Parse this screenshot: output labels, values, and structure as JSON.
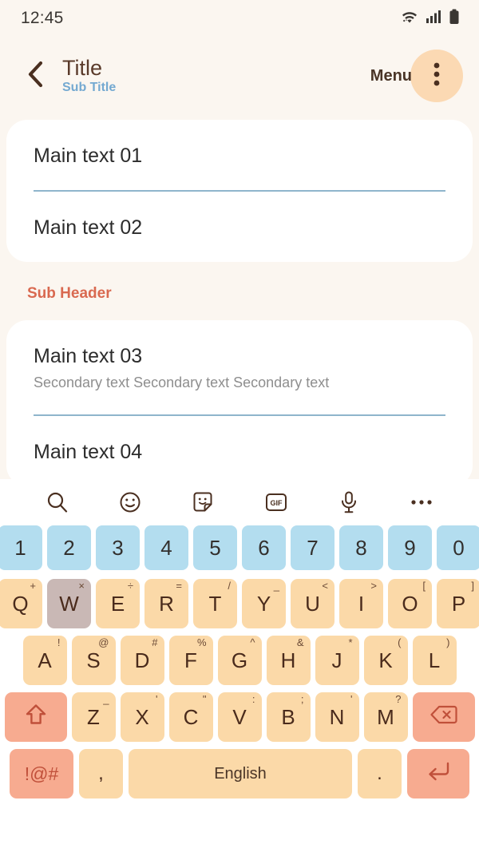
{
  "status_bar": {
    "time": "12:45",
    "icons": [
      "wifi-icon",
      "signal-icon",
      "battery-icon"
    ]
  },
  "app_bar": {
    "back_icon": "back-chevron-icon",
    "title": "Title",
    "subtitle": "Sub Title",
    "menu_label": "Menu",
    "overflow_icon": "overflow-menu-icon",
    "accent_color": "#fbd9b3",
    "title_color": "#5a3a2a",
    "subtitle_color": "#74a9d1"
  },
  "content": {
    "group_one": [
      {
        "main": "Main text 01",
        "secondary": ""
      },
      {
        "main": "Main text 02",
        "secondary": ""
      }
    ],
    "sub_header": "Sub Header",
    "sub_header_color": "#d96950",
    "group_two": [
      {
        "main": "Main text 03",
        "secondary": "Secondary text Secondary text Secondary text"
      },
      {
        "main": "Main text 04",
        "secondary": ""
      }
    ],
    "divider_color": "#8fb5cc"
  },
  "keyboard": {
    "toolbar": [
      {
        "name": "search-icon",
        "label": ""
      },
      {
        "name": "emoji-icon",
        "label": ""
      },
      {
        "name": "sticker-icon",
        "label": ""
      },
      {
        "name": "gif-icon",
        "label": "GIF"
      },
      {
        "name": "microphone-icon",
        "label": ""
      },
      {
        "name": "more-options-icon",
        "label": ""
      }
    ],
    "number_row": [
      "1",
      "2",
      "3",
      "4",
      "5",
      "6",
      "7",
      "8",
      "9",
      "0"
    ],
    "row_qwerty": [
      {
        "label": "Q",
        "sup": "+",
        "pressed": false
      },
      {
        "label": "W",
        "sup": "×",
        "pressed": true
      },
      {
        "label": "E",
        "sup": "÷",
        "pressed": false
      },
      {
        "label": "R",
        "sup": "=",
        "pressed": false
      },
      {
        "label": "T",
        "sup": "/",
        "pressed": false
      },
      {
        "label": "Y",
        "sup": "_",
        "pressed": false
      },
      {
        "label": "U",
        "sup": "<",
        "pressed": false
      },
      {
        "label": "I",
        "sup": ">",
        "pressed": false
      },
      {
        "label": "O",
        "sup": "[",
        "pressed": false
      },
      {
        "label": "P",
        "sup": "]",
        "pressed": false
      }
    ],
    "row_asdf": [
      {
        "label": "A",
        "sup": "!"
      },
      {
        "label": "S",
        "sup": "@"
      },
      {
        "label": "D",
        "sup": "#"
      },
      {
        "label": "F",
        "sup": "%"
      },
      {
        "label": "G",
        "sup": "^"
      },
      {
        "label": "H",
        "sup": "&"
      },
      {
        "label": "J",
        "sup": "*"
      },
      {
        "label": "K",
        "sup": "("
      },
      {
        "label": "L",
        "sup": ")"
      }
    ],
    "row_zxcv": [
      {
        "label": "Z",
        "sup": "_"
      },
      {
        "label": "X",
        "sup": "'"
      },
      {
        "label": "C",
        "sup": "\""
      },
      {
        "label": "V",
        "sup": ":"
      },
      {
        "label": "B",
        "sup": ";"
      },
      {
        "label": "N",
        "sup": "'"
      },
      {
        "label": "M",
        "sup": "?"
      }
    ],
    "shift_key": "shift-icon",
    "backspace_key": "backspace-icon",
    "symbols_key": "!@#",
    "comma_key": ",",
    "space_key": "English",
    "period_key": ".",
    "enter_key": "enter-icon",
    "key_color": "#fbd9a8",
    "number_key_color": "#b3ddef",
    "accent_key_color": "#f7ab90",
    "pressed_key_color": "#c9b8b5"
  }
}
